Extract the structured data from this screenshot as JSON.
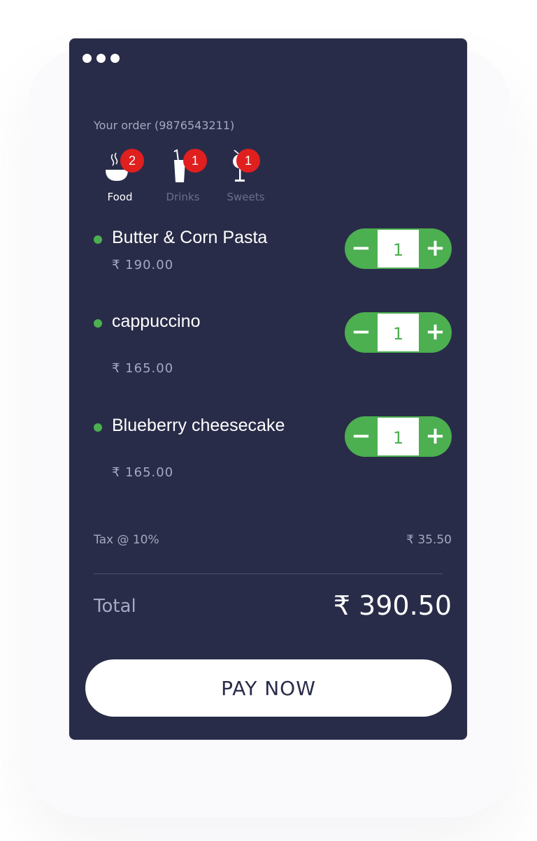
{
  "header": {
    "order_title": "Your order (9876543211)"
  },
  "tabs": [
    {
      "label": "Food",
      "badge": "2",
      "icon": "bowl-icon",
      "active": true
    },
    {
      "label": "Drinks",
      "badge": "1",
      "icon": "drink-glass-icon",
      "active": false
    },
    {
      "label": "Sweets",
      "badge": "1",
      "icon": "ice-cream-icon",
      "active": false
    }
  ],
  "items": [
    {
      "name": "Butter & Corn Pasta",
      "price": "₹ 190.00",
      "qty": "1",
      "minus": "−",
      "plus": "+"
    },
    {
      "name": "cappuccino",
      "price": "₹ 165.00",
      "qty": "1",
      "minus": "−",
      "plus": "+"
    },
    {
      "name": "Blueberry cheesecake",
      "price": "₹ 165.00",
      "qty": "1",
      "minus": "−",
      "plus": "+"
    }
  ],
  "summary": {
    "tax_label": "Tax @ 10%",
    "tax_value": "₹ 35.50",
    "total_label": "Total",
    "total_value": "₹ 390.50"
  },
  "pay_button": "PAY NOW",
  "colors": {
    "card_bg": "#292c48",
    "accent_green": "#4caf50",
    "badge_red": "#e01f1f",
    "muted_text": "#a5a8c0"
  }
}
